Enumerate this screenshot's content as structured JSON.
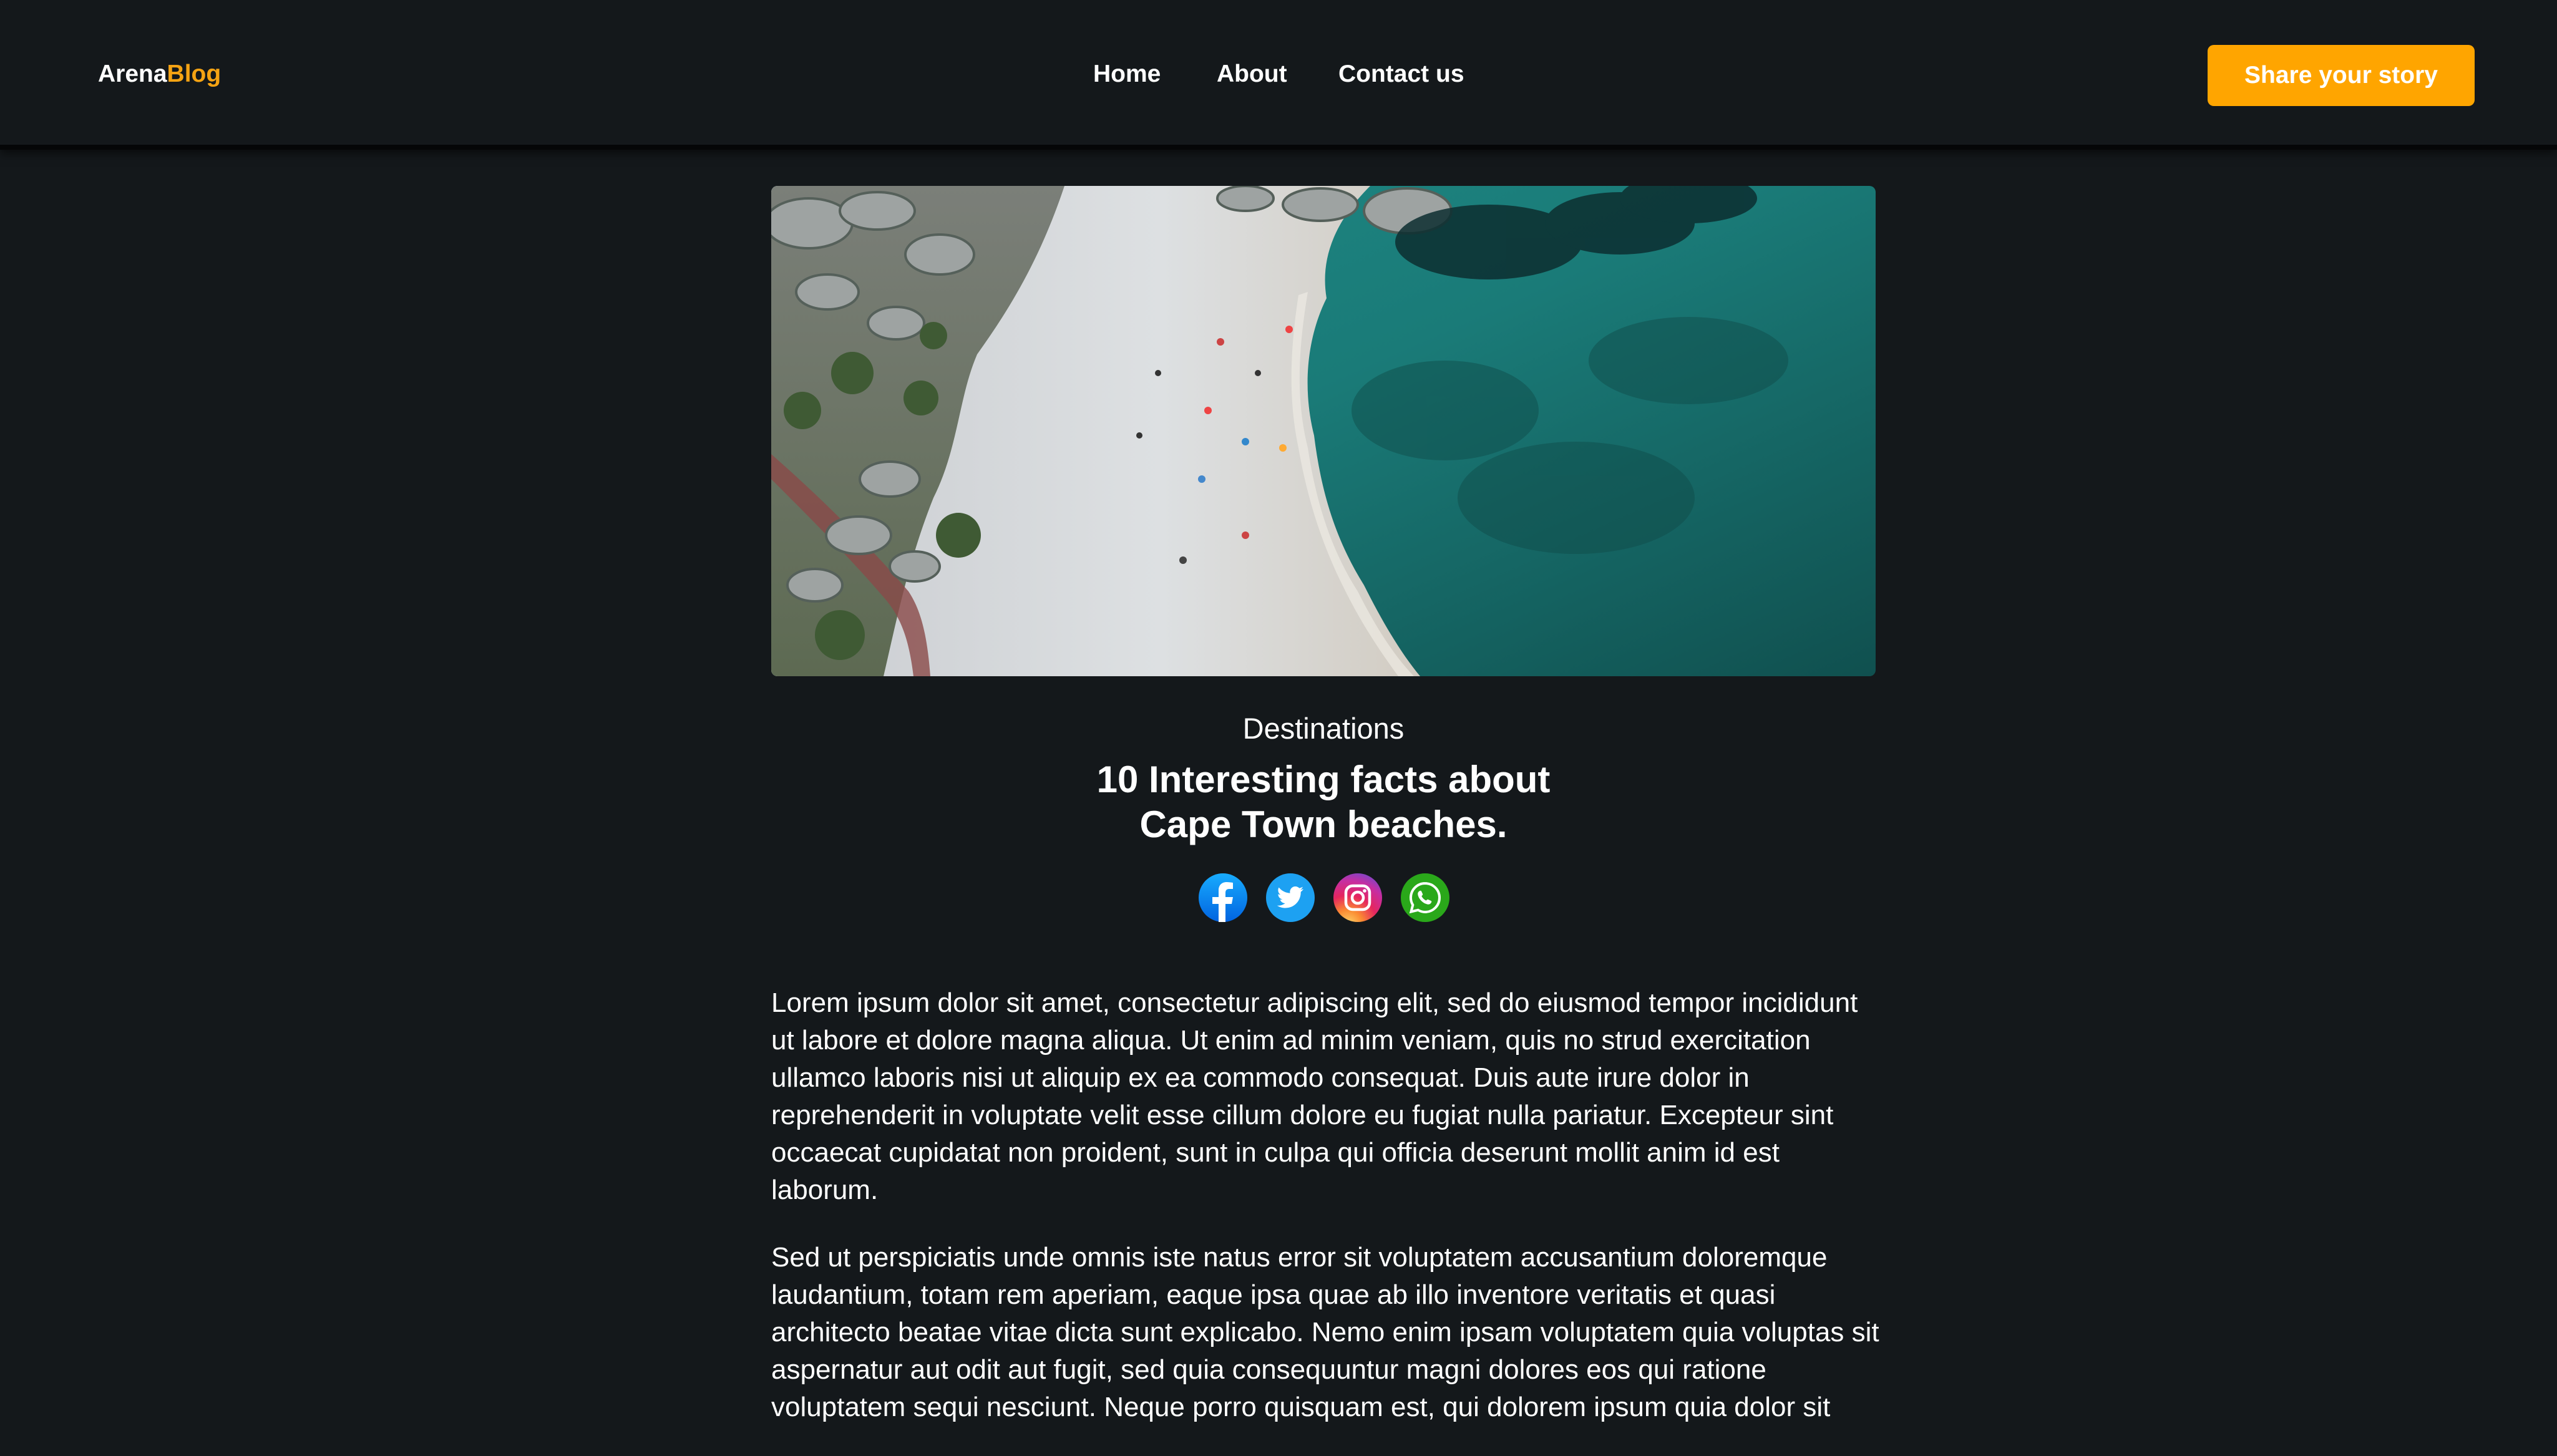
{
  "brand": {
    "part1": "Arena",
    "part2": "Blog"
  },
  "nav": {
    "home": "Home",
    "about": "About",
    "contact": "Contact us"
  },
  "cta": {
    "label": "Share your story"
  },
  "hero": {
    "icon": "beach-aerial-photo"
  },
  "article": {
    "category": "Destinations",
    "title_line1": "10 Interesting facts about",
    "title_line2": "Cape Town beaches.",
    "paragraph1": "Lorem ipsum dolor sit amet, consectetur adipiscing elit, sed do eiusmod tempor incididunt ut labore et dolore magna aliqua. Ut enim ad minim veniam, quis no strud exercitation ullamco laboris nisi ut aliquip ex ea commodo consequat. Duis aute irure dolor in reprehenderit in voluptate velit esse cillum dolore eu fugiat nulla pariatur. Excepteur sint occaecat cupidatat non proident, sunt in culpa qui officia deserunt mollit anim id est laborum.",
    "paragraph2": "Sed ut perspiciatis unde omnis iste natus error sit voluptatem accusantium doloremque laudantium, totam rem aperiam, eaque ipsa quae ab illo inventore veritatis et quasi architecto beatae vitae dicta sunt explicabo. Nemo enim ipsam voluptatem quia voluptas sit aspernatur aut odit aut fugit, sed quia consequuntur magni dolores eos qui ratione voluptatem sequi nesciunt. Neque porro quisquam est, qui dolorem ipsum quia dolor sit"
  },
  "socials": [
    {
      "icon": "facebook-icon"
    },
    {
      "icon": "twitter-icon"
    },
    {
      "icon": "instagram-icon"
    },
    {
      "icon": "whatsapp-icon"
    }
  ],
  "colors": {
    "background": "#14181b",
    "accent": "#ffa500",
    "brand_accent": "#f5a313",
    "text": "#ffffff"
  }
}
